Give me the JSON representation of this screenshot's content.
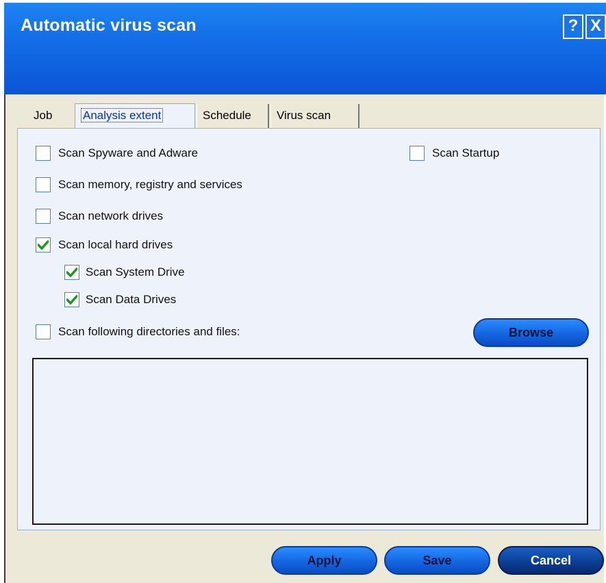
{
  "window": {
    "title": "Automatic virus scan",
    "help_label": "?",
    "close_label": "X"
  },
  "tabs": [
    {
      "label": "Job",
      "active": false
    },
    {
      "label": "Analysis extent",
      "active": true
    },
    {
      "label": "Schedule",
      "active": false
    },
    {
      "label": "Virus scan",
      "active": false
    }
  ],
  "options": {
    "spyware": {
      "label": "Scan Spyware and Adware",
      "checked": false
    },
    "startup": {
      "label": "Scan Startup",
      "checked": false
    },
    "memory": {
      "label": "Scan memory, registry and services",
      "checked": false
    },
    "network": {
      "label": "Scan network drives",
      "checked": false
    },
    "local_hd": {
      "label": "Scan local hard drives",
      "checked": true
    },
    "system_drive": {
      "label": "Scan System Drive",
      "checked": true
    },
    "data_drives": {
      "label": "Scan Data Drives",
      "checked": true
    },
    "directories": {
      "label": "Scan following directories and files:",
      "checked": false
    }
  },
  "browse_label": "Browse",
  "footer": {
    "apply": "Apply",
    "save": "Save",
    "cancel": "Cancel"
  },
  "colors": {
    "title_bar": "#1570e8",
    "check_green": "#1a9a1a",
    "button_blue": "#1466e0"
  },
  "icons": {
    "check": "check-icon",
    "help": "help-icon",
    "close": "close-icon"
  }
}
